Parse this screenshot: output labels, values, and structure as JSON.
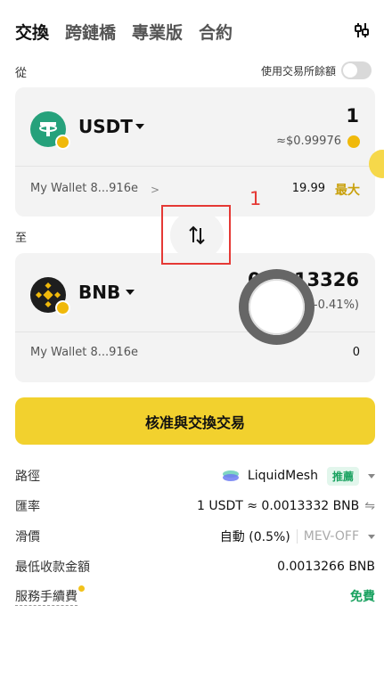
{
  "tabs": [
    "交換",
    "跨鏈橋",
    "專業版",
    "合約"
  ],
  "from_section": {
    "label": "從",
    "use_balance_label": "使用交易所餘額",
    "token": "USDT",
    "amount": "1",
    "usd_value": "≈$0.99976",
    "wallet": "My Wallet 8...916e",
    "balance": "19.99",
    "max_label": "最大"
  },
  "to_section": {
    "label": "至",
    "token": "BNB",
    "amount": "0.0013326",
    "usd_value": "(-0.41%)",
    "wallet": "My Wallet 8...916e",
    "balance": "0"
  },
  "annotation": {
    "number": "1"
  },
  "approve_button": "核准與交換交易",
  "details": {
    "route_label": "路徑",
    "route_value": "LiquidMesh",
    "route_badge": "推薦",
    "rate_label": "匯率",
    "rate_value": "1 USDT ≈ 0.0013332 BNB",
    "slippage_label": "滑價",
    "slippage_value": "自動 (0.5%)",
    "mev_value": "MEV-OFF",
    "min_received_label": "最低收款金額",
    "min_received_value": "0.0013266 BNB",
    "fee_label": "服務手續費",
    "fee_value": "免費"
  },
  "colors": {
    "accent_yellow": "#f2d12e",
    "usdt_green": "#26a17b",
    "recommend_green": "#1aa260",
    "annotation_red": "#e53935"
  }
}
